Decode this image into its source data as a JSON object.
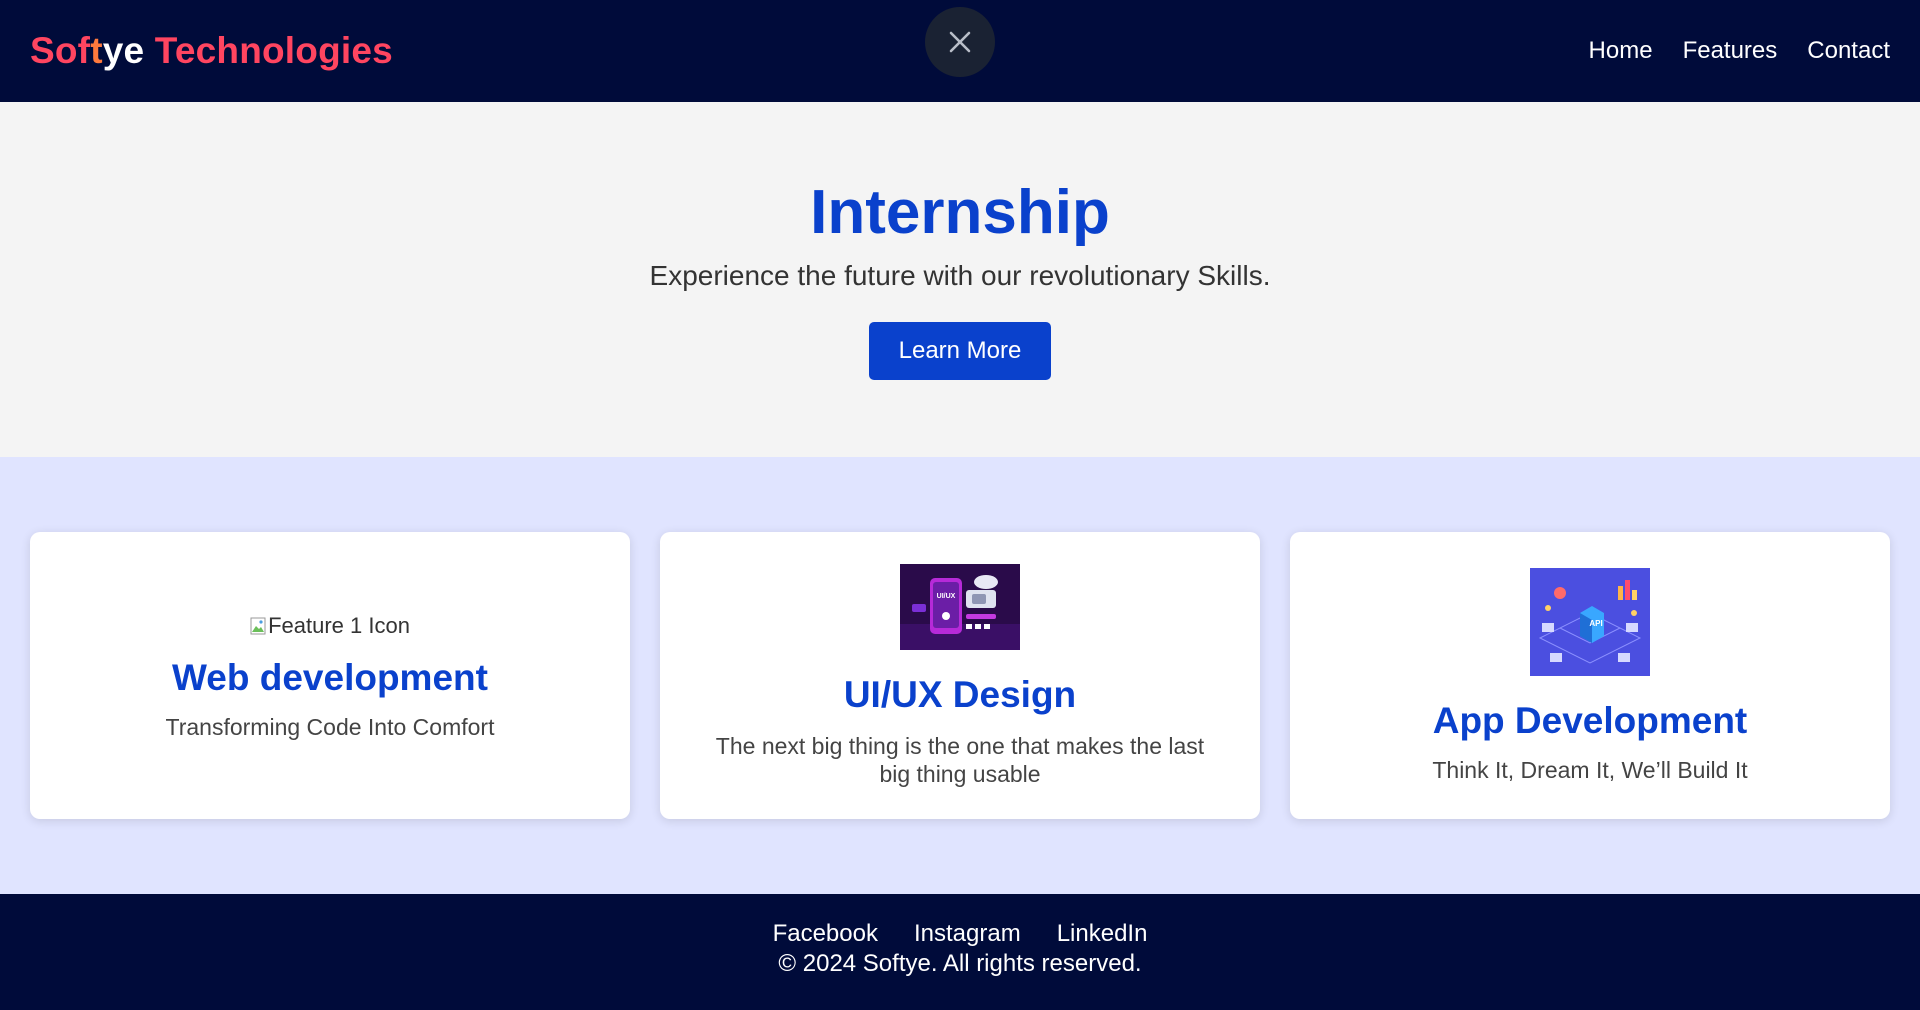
{
  "header": {
    "logo_parts": [
      "Sof",
      "t",
      "ye",
      " Technologies"
    ],
    "close_icon": "close-icon",
    "nav": [
      {
        "label": "Home"
      },
      {
        "label": "Features"
      },
      {
        "label": "Contact"
      }
    ]
  },
  "hero": {
    "title": "Internship",
    "subtitle": "Experience the future with our revolutionary Skills.",
    "cta_label": "Learn More"
  },
  "features": [
    {
      "image_alt": "Feature 1 Icon",
      "title": "Web development",
      "description": "Transforming Code Into Comfort"
    },
    {
      "image_label": "UI/UX",
      "title": "UI/UX Design",
      "description": "The next big thing is the one that makes the last big thing usable"
    },
    {
      "image_label": "API",
      "title": "App Development",
      "description": "Think It, Dream It, We’ll Build It"
    }
  ],
  "footer": {
    "links": [
      {
        "label": "Facebook"
      },
      {
        "label": "Instagram"
      },
      {
        "label": "LinkedIn"
      }
    ],
    "copyright": "© 2024 Softye. All rights reserved."
  },
  "colors": {
    "nav_bg": "#000b3a",
    "brand_primary": "#0a41cc",
    "logo_pink": "#ff4560",
    "features_bg": "#e0e4ff"
  }
}
